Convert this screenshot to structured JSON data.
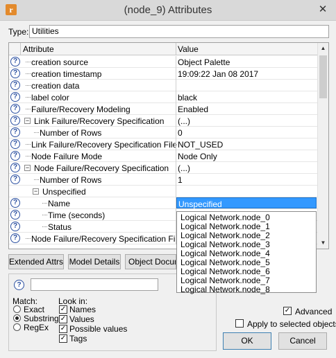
{
  "window": {
    "title": "(node_9) Attributes",
    "close_glyph": "✕",
    "app_icon_glyph": "r"
  },
  "type": {
    "label": "Type:",
    "value": "Utilities"
  },
  "table": {
    "header_attribute": "Attribute",
    "header_value": "Value",
    "rows": [
      {
        "name": "creation source",
        "value": "Object Palette",
        "help": true,
        "level": 0
      },
      {
        "name": "creation timestamp",
        "value": "19:09:22 Jan 08 2017",
        "help": true,
        "level": 0
      },
      {
        "name": "creation data",
        "value": "",
        "help": true,
        "level": 0
      },
      {
        "name": "label color",
        "value": "black",
        "help": true,
        "level": 0
      },
      {
        "name": "Failure/Recovery Modeling",
        "value": "Enabled",
        "help": true,
        "level": 0
      },
      {
        "name": "Link Failure/Recovery Specification",
        "value": "(...)",
        "help": true,
        "level": 0,
        "expander": "−"
      },
      {
        "name": "Number of Rows",
        "value": "0",
        "help": true,
        "level": 1
      },
      {
        "name": "Link Failure/Recovery Specification File",
        "value": "NOT_USED",
        "help": true,
        "level": 0
      },
      {
        "name": "Node Failure Mode",
        "value": "Node Only",
        "help": true,
        "level": 0
      },
      {
        "name": "Node Failure/Recovery Specification",
        "value": "(...)",
        "help": true,
        "level": 0,
        "expander": "−"
      },
      {
        "name": "Number of Rows",
        "value": "1",
        "help": true,
        "level": 1
      },
      {
        "name": "Unspecified",
        "value": "",
        "help": false,
        "level": 1,
        "expander": "−"
      },
      {
        "name": "Name",
        "value": "Unspecified",
        "help": true,
        "level": 2,
        "selected": true
      },
      {
        "name": "Time (seconds)",
        "value": "",
        "help": true,
        "level": 2
      },
      {
        "name": "Status",
        "value": "",
        "help": true,
        "level": 2
      },
      {
        "name": "Node Failure/Recovery Specification File",
        "value": "",
        "help": true,
        "level": 0
      }
    ]
  },
  "dropdown": {
    "options": [
      "Logical Network.node_0",
      "Logical Network.node_1",
      "Logical Network.node_2",
      "Logical Network.node_3",
      "Logical Network.node_4",
      "Logical Network.node_5",
      "Logical Network.node_6",
      "Logical Network.node_7",
      "Logical Network.node_8"
    ]
  },
  "buttons": {
    "extended_attrs": "Extended Attrs.",
    "model_details": "Model Details",
    "object_documentation": "Object Documentation",
    "ok": "OK",
    "cancel": "Cancel"
  },
  "search": {
    "match_label": "Match:",
    "match_options": [
      {
        "label": "Exact",
        "selected": false
      },
      {
        "label": "Substring",
        "selected": true
      },
      {
        "label": "RegEx",
        "selected": false
      }
    ],
    "look_in_label": "Look in:",
    "look_in_options": [
      {
        "label": "Names",
        "checked": true
      },
      {
        "label": "Values",
        "checked": true
      },
      {
        "label": "Possible values",
        "checked": true
      },
      {
        "label": "Tags",
        "checked": true
      }
    ]
  },
  "options": {
    "advanced": {
      "label": "Advanced",
      "checked": true
    },
    "apply_selected": {
      "label": "Apply to selected objects",
      "checked": false
    }
  }
}
